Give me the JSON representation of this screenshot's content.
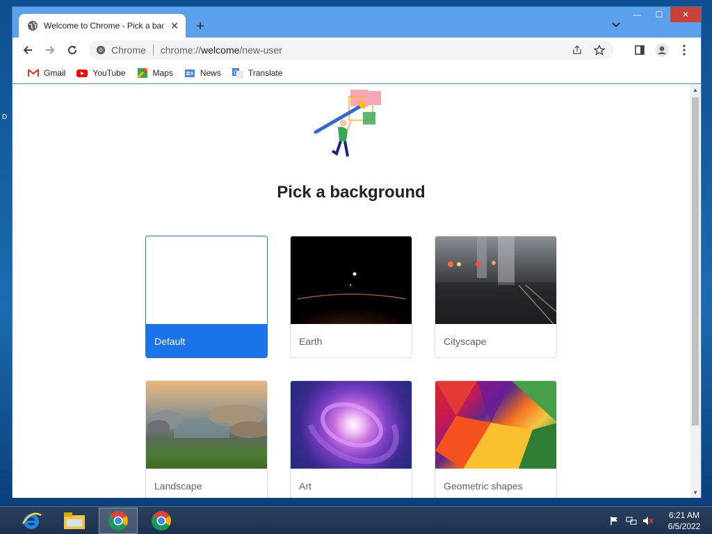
{
  "desktop": {
    "label": "D"
  },
  "browser": {
    "tab": {
      "title": "Welcome to Chrome - Pick a background",
      "close": "✕"
    },
    "new_tab": "+",
    "window_controls": {
      "minimize": "—",
      "maximize": "☐",
      "close": "✕"
    },
    "omnibox": {
      "site_label": "Chrome",
      "url_prefix": "chrome://",
      "url_host": "welcome",
      "url_path": "/new-user"
    },
    "bookmarks": [
      {
        "label": "Gmail",
        "icon": "gmail-icon"
      },
      {
        "label": "YouTube",
        "icon": "youtube-icon"
      },
      {
        "label": "Maps",
        "icon": "maps-icon"
      },
      {
        "label": "News",
        "icon": "news-icon"
      },
      {
        "label": "Translate",
        "icon": "translate-icon"
      }
    ]
  },
  "page": {
    "heading": "Pick a background",
    "backgrounds": [
      {
        "label": "Default",
        "selected": true
      },
      {
        "label": "Earth",
        "selected": false
      },
      {
        "label": "Cityscape",
        "selected": false
      },
      {
        "label": "Landscape",
        "selected": false
      },
      {
        "label": "Art",
        "selected": false
      },
      {
        "label": "Geometric shapes",
        "selected": false
      }
    ]
  },
  "taskbar": {
    "apps": [
      "internet-explorer-icon",
      "file-explorer-icon",
      "chrome-icon",
      "chrome-icon"
    ],
    "clock": {
      "time": "6:21 AM",
      "date": "6/5/2022"
    }
  },
  "colors": {
    "accent": "#1a73e8",
    "title_bar": "#5aa0ea",
    "close_button": "#c7403a"
  }
}
